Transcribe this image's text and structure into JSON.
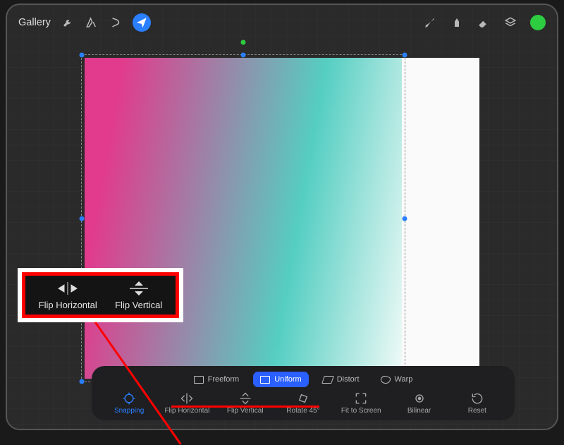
{
  "topbar": {
    "gallery": "Gallery"
  },
  "modes": {
    "freeform": "Freeform",
    "uniform": "Uniform",
    "distort": "Distort",
    "warp": "Warp"
  },
  "actions": {
    "snapping": "Snapping",
    "flip_horizontal": "Flip Horizontal",
    "flip_vertical": "Flip Vertical",
    "rotate_45": "Rotate 45°",
    "fit_to_screen": "Fit to Screen",
    "bilinear": "Bilinear",
    "reset": "Reset"
  },
  "callout": {
    "flip_horizontal": "Flip Horizontal",
    "flip_vertical": "Flip Vertical"
  },
  "colors": {
    "accent": "#2a7fff",
    "swatch": "#2ecc40"
  }
}
